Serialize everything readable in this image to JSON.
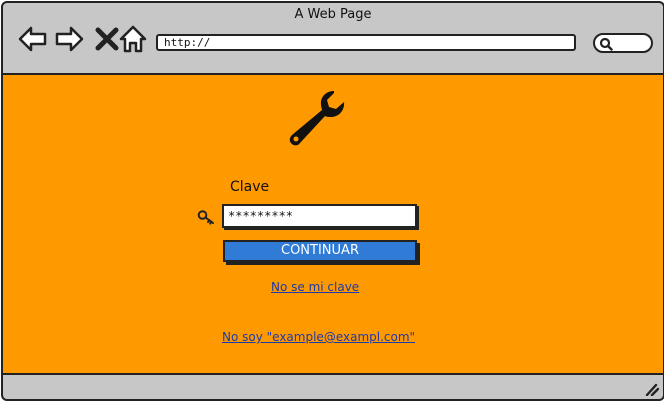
{
  "window": {
    "title": "A Web Page"
  },
  "toolbar": {
    "back_icon": "back-arrow-icon",
    "forward_icon": "forward-arrow-icon",
    "stop_icon": "close-icon",
    "home_icon": "home-icon",
    "address": "http://",
    "search_icon": "search-icon"
  },
  "main": {
    "header_icon": "wrench-icon",
    "password_label": "Clave",
    "password_value": "*********",
    "key_icon": "key-icon",
    "continue_label": "CONTINUAR",
    "forgot_link": "No se mi clave",
    "not_me_link": "No soy \"example@exampl.com\""
  },
  "colors": {
    "background": "#ff9900",
    "button": "#2f7bd6",
    "link": "#1c3aa8",
    "chrome": "#c7c7c7"
  }
}
